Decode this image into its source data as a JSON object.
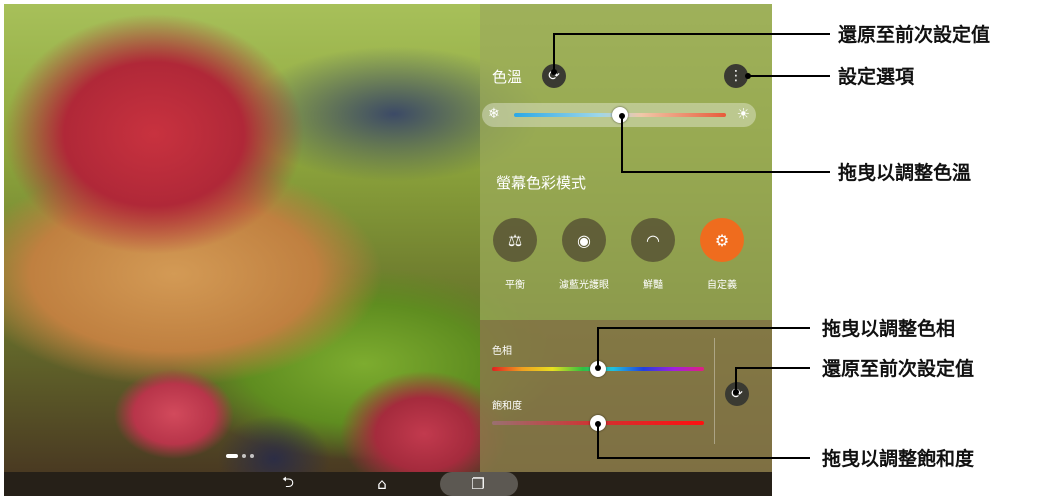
{
  "panel": {
    "title": "色溫",
    "section_label": "螢幕色彩模式",
    "color_temp_level": 0.5,
    "modes": [
      {
        "label": "平衡",
        "icon": "balance-icon",
        "active": false
      },
      {
        "label": "濾藍光護眼",
        "icon": "eye-shield-icon",
        "active": false
      },
      {
        "label": "鮮豔",
        "icon": "vivid-icon",
        "active": false
      },
      {
        "label": "自定義",
        "icon": "custom-icon",
        "active": true
      }
    ],
    "hue_label": "色相",
    "hue_level": 0.5,
    "saturation_label": "飽和度",
    "saturation_level": 0.5
  },
  "callouts": {
    "reset_previous_top": "還原至前次設定值",
    "settings_options": "設定選項",
    "drag_color_temp": "拖曳以調整色溫",
    "drag_hue": "拖曳以調整色相",
    "reset_previous_bottom": "還原至前次設定值",
    "drag_saturation": "拖曳以調整飽和度"
  },
  "icons": {
    "reset": "reset-icon",
    "menu": "more-vertical-icon",
    "cold": "snowflake-icon",
    "warm": "sun-icon",
    "back": "back-icon",
    "home": "home-icon",
    "recent": "recent-apps-icon"
  },
  "colors": {
    "accent": "#ef6c1e",
    "callout_line": "#000000"
  }
}
